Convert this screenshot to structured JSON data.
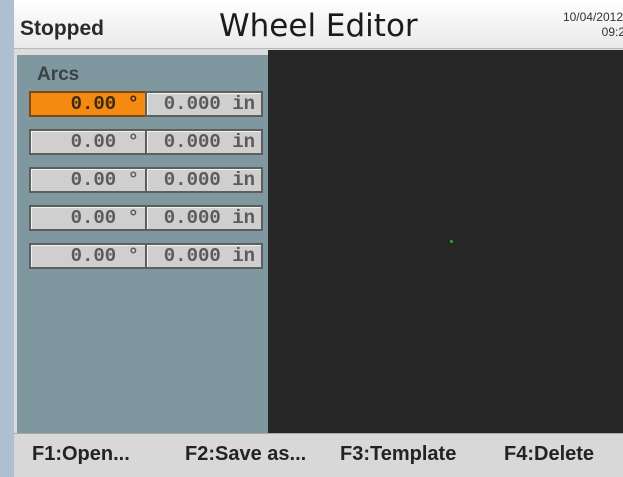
{
  "header": {
    "status": "Stopped",
    "title": "Wheel Editor",
    "date": "10/04/2012",
    "time": "09:2"
  },
  "arcs_panel": {
    "label": "Arcs",
    "rows": [
      {
        "angle": "0.00 °",
        "length": "0.000 in",
        "selected": true
      },
      {
        "angle": "0.00 °",
        "length": "0.000 in",
        "selected": false
      },
      {
        "angle": "0.00 °",
        "length": "0.000 in",
        "selected": false
      },
      {
        "angle": "0.00 °",
        "length": "0.000 in",
        "selected": false
      },
      {
        "angle": "0.00 °",
        "length": "0.000 in",
        "selected": false
      }
    ]
  },
  "footer": {
    "f1": "F1:Open...",
    "f2": "F2:Save as...",
    "f3": "F3:Template",
    "f4": "F4:Delete"
  },
  "colors": {
    "selected_field": "#f48a12",
    "panel_bg": "#7f979e",
    "viewport_bg": "#262626",
    "origin_marker": "#2fa82f"
  }
}
